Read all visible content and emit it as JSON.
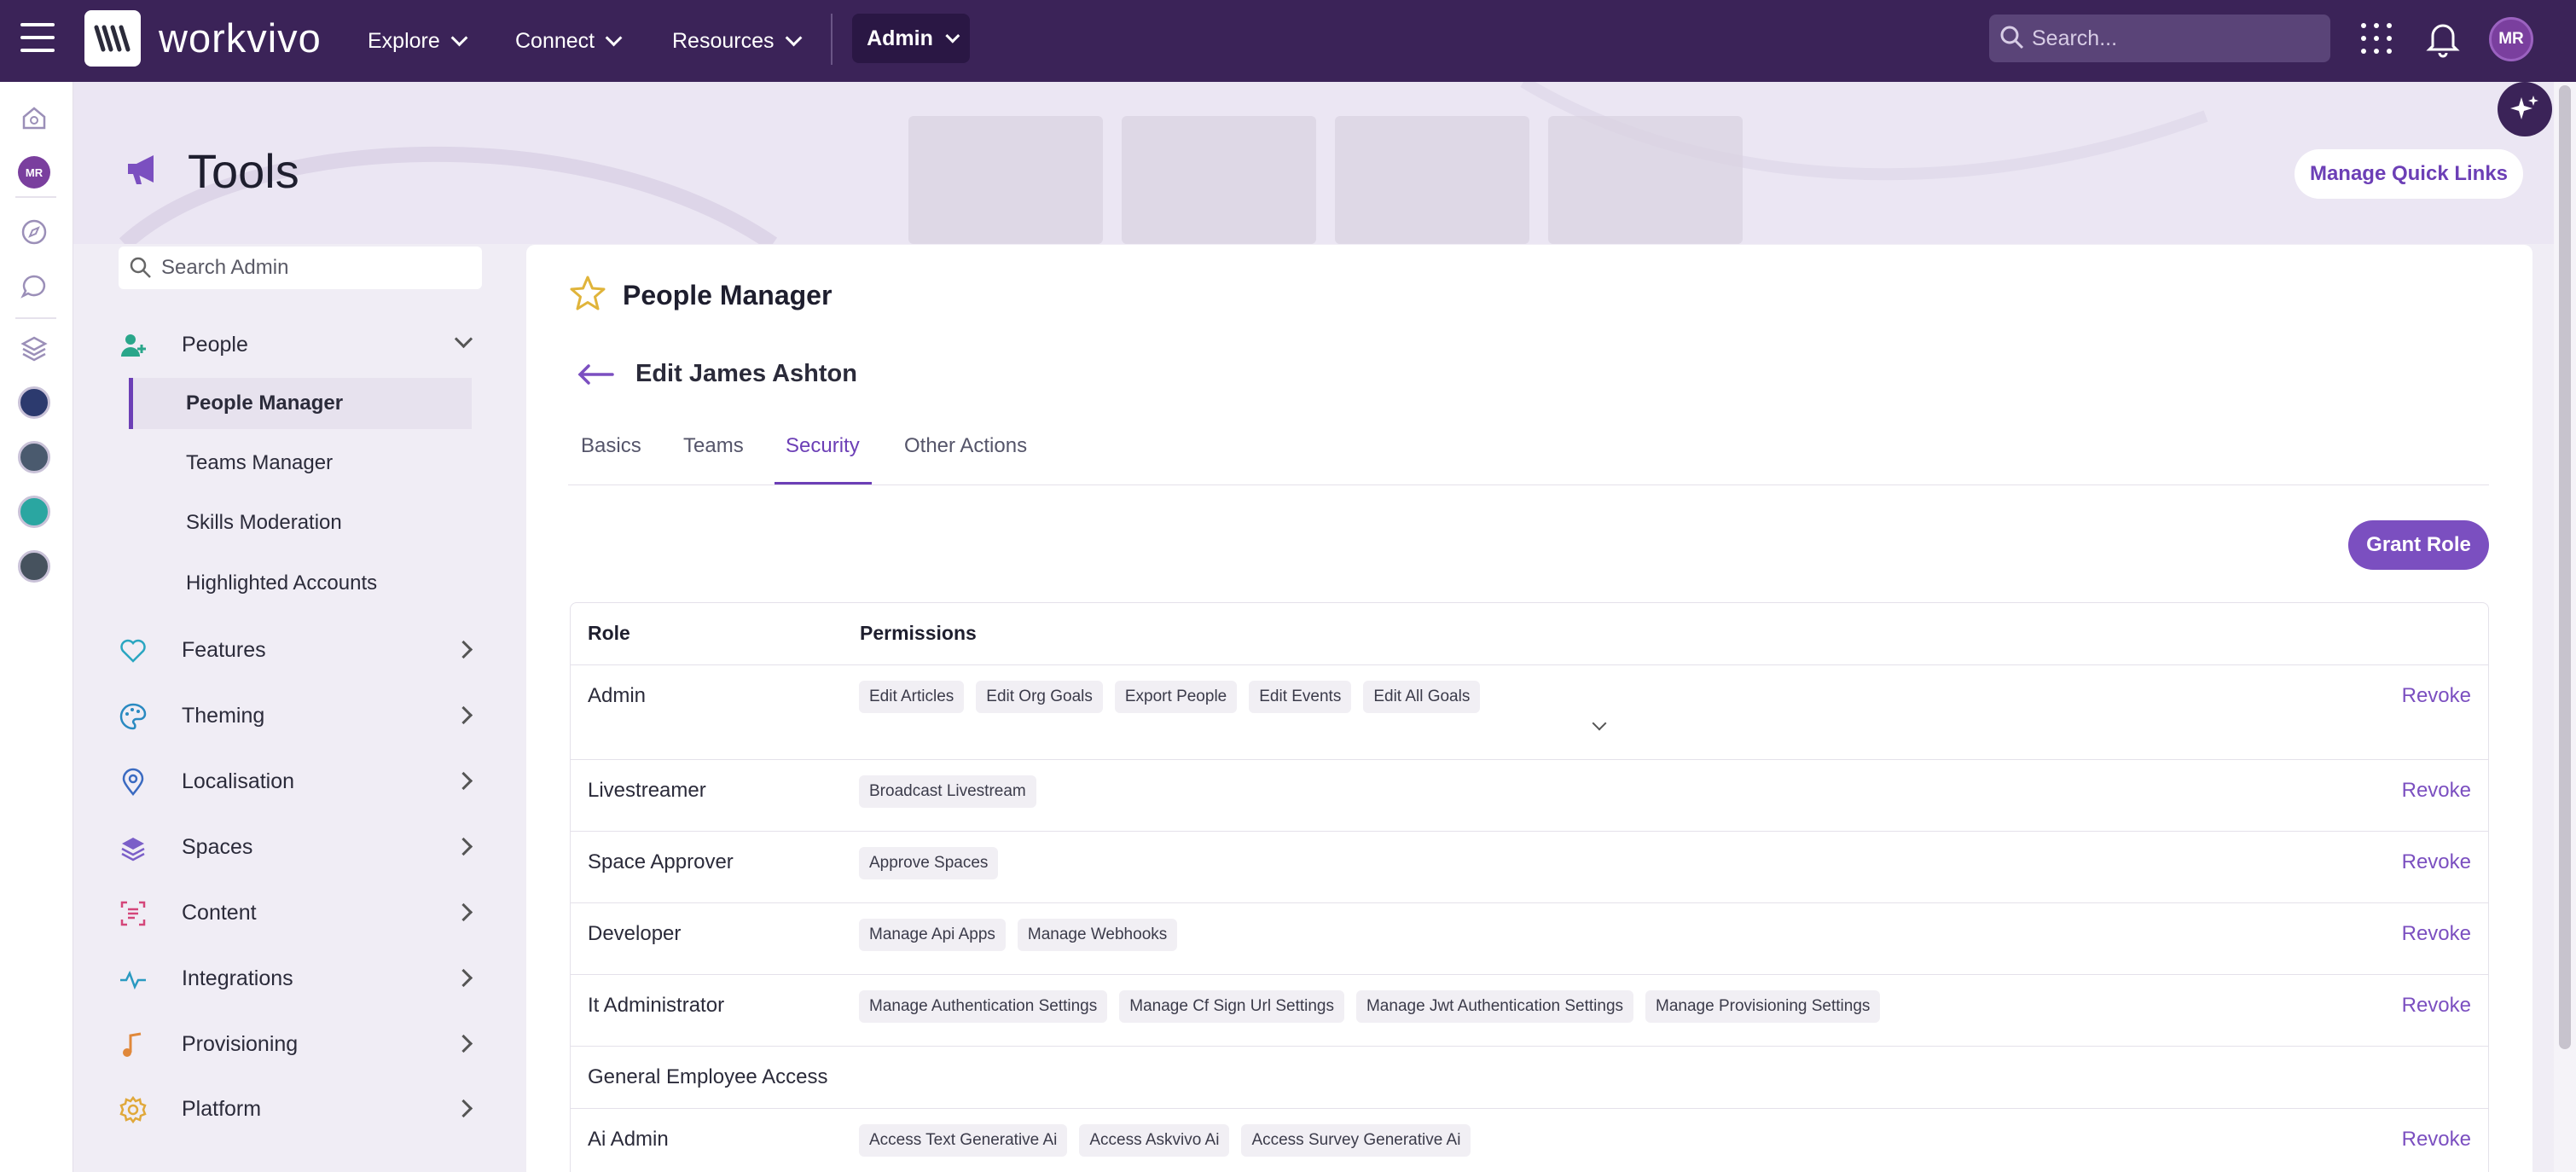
{
  "topbar": {
    "brand": "workvivo",
    "nav": [
      {
        "label": "Explore"
      },
      {
        "label": "Connect"
      },
      {
        "label": "Resources"
      }
    ],
    "admin_label": "Admin",
    "search_placeholder": "Search...",
    "avatar_initials": "MR"
  },
  "rail": {
    "avatar_initials": "MR"
  },
  "header": {
    "title": "Tools",
    "quick_links": "Manage Quick Links"
  },
  "sidebar": {
    "search_placeholder": "Search Admin",
    "people": {
      "label": "People",
      "items": [
        {
          "label": "People Manager"
        },
        {
          "label": "Teams Manager"
        },
        {
          "label": "Skills Moderation"
        },
        {
          "label": "Highlighted Accounts"
        }
      ]
    },
    "sections": [
      {
        "label": "Features"
      },
      {
        "label": "Theming"
      },
      {
        "label": "Localisation"
      },
      {
        "label": "Spaces"
      },
      {
        "label": "Content"
      },
      {
        "label": "Integrations"
      },
      {
        "label": "Provisioning"
      },
      {
        "label": "Platform"
      }
    ]
  },
  "main": {
    "title": "People Manager",
    "edit_title": "Edit James Ashton",
    "tabs": [
      {
        "label": "Basics"
      },
      {
        "label": "Teams"
      },
      {
        "label": "Security"
      },
      {
        "label": "Other Actions"
      }
    ],
    "grant_role": "Grant Role",
    "table": {
      "headers": {
        "role": "Role",
        "permissions": "Permissions"
      },
      "revoke_label": "Revoke",
      "rows": [
        {
          "role": "Admin",
          "permissions": [
            "Edit Articles",
            "Edit Org Goals",
            "Export People",
            "Edit Events",
            "Edit All Goals"
          ]
        },
        {
          "role": "Livestreamer",
          "permissions": [
            "Broadcast Livestream"
          ]
        },
        {
          "role": "Space Approver",
          "permissions": [
            "Approve Spaces"
          ]
        },
        {
          "role": "Developer",
          "permissions": [
            "Manage Api Apps",
            "Manage Webhooks"
          ]
        },
        {
          "role": "It Administrator",
          "permissions": [
            "Manage Authentication Settings",
            "Manage Cf Sign Url Settings",
            "Manage Jwt Authentication Settings",
            "Manage Provisioning Settings"
          ]
        },
        {
          "role": "General Employee Access",
          "permissions": []
        },
        {
          "role": "Ai Admin",
          "permissions": [
            "Access Text Generative Ai",
            "Access Askvivo Ai",
            "Access Survey Generative Ai"
          ]
        }
      ]
    }
  },
  "colors": {
    "topbar": "#3b2358",
    "accent": "#7b4fc0",
    "active_tab": "#6c3fb6"
  }
}
